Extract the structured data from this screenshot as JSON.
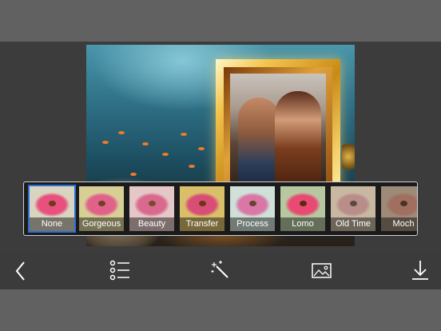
{
  "editor": {
    "filters": [
      {
        "label": "None",
        "selected": true,
        "bg": "#d9d4c0",
        "petal": "#e8507d",
        "center": "#6a3a1a"
      },
      {
        "label": "Gorgeous",
        "selected": false,
        "bg": "#d8cf97",
        "petal": "#e0628a",
        "center": "#704020"
      },
      {
        "label": "Beauty",
        "selected": false,
        "bg": "#e6c7c7",
        "petal": "#d96a8e",
        "center": "#7a4a30"
      },
      {
        "label": "Transfer",
        "selected": false,
        "bg": "#d9bf6a",
        "petal": "#d94e77",
        "center": "#6e3516"
      },
      {
        "label": "Process",
        "selected": false,
        "bg": "#cfe0d8",
        "petal": "#d977a6",
        "center": "#6a4230"
      },
      {
        "label": "Lomo",
        "selected": false,
        "bg": "#b7c8a0",
        "petal": "#e84a73",
        "center": "#5a2a10"
      },
      {
        "label": "Old Time",
        "selected": false,
        "bg": "#c8b8a2",
        "petal": "#b98d8a",
        "center": "#5e4a3a"
      },
      {
        "label": "Moch",
        "selected": false,
        "bg": "#9e8a78",
        "petal": "#a06f60",
        "center": "#4a3326"
      }
    ],
    "toolbar": {
      "icons": [
        "back-icon",
        "list-icon",
        "magic-wand-icon",
        "image-icon",
        "download-icon"
      ]
    }
  },
  "colors": {
    "accent": "#2b6fd6",
    "toolbar_bg": "#3b3b3b",
    "outer_bg": "#616161"
  }
}
